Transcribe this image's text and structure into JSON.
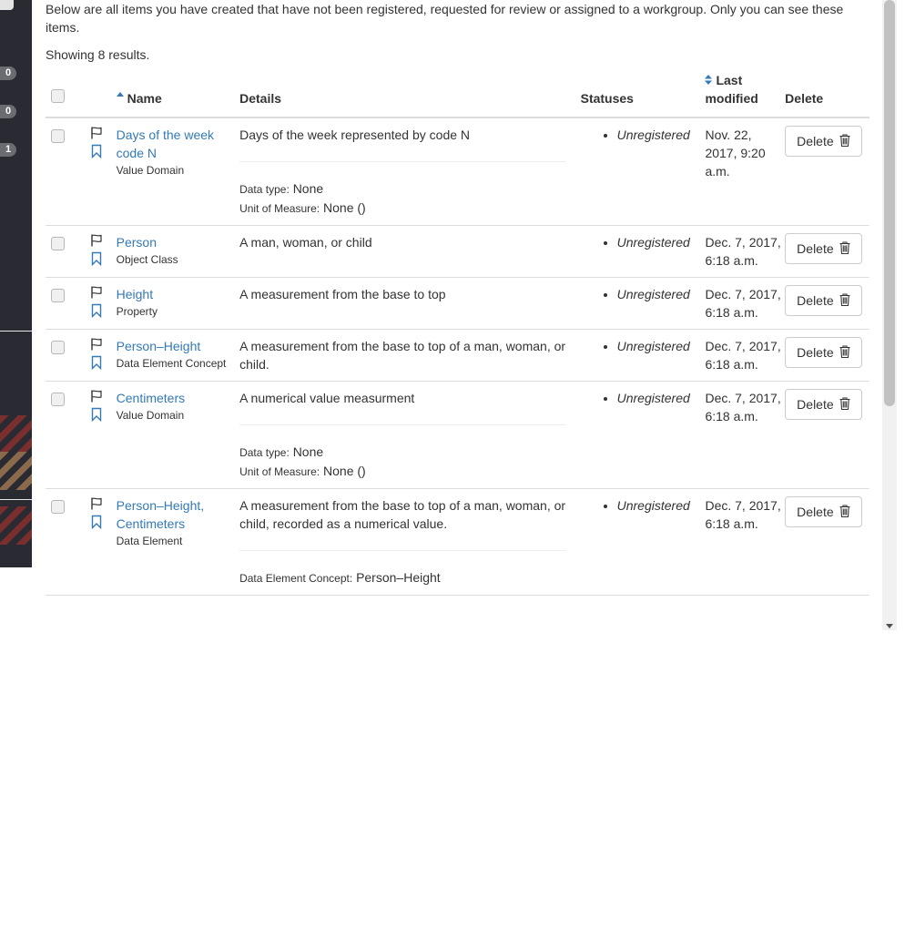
{
  "sidebar": {
    "badges": [
      "0",
      "0",
      "1"
    ]
  },
  "intro": "Below are all items you have created that have not been registered, requested for review or assigned to a workgroup. Only you can see these items.",
  "results_text": "Showing 8 results.",
  "table": {
    "headers": {
      "name": "Name",
      "details": "Details",
      "statuses": "Statuses",
      "last_modified": "Last modified",
      "delete": "Delete"
    },
    "rows": [
      {
        "name": "Days of the week code N",
        "type": "Value Domain",
        "description": "Days of the week represented by code N",
        "data_type_label": "Data type:",
        "data_type": "None",
        "uom_label": "Unit of Measure:",
        "uom": "None ()",
        "status": "Unregistered",
        "modified": "Nov. 22, 2017, 9:20 a.m.",
        "delete_label": "Delete"
      },
      {
        "name": "Person",
        "type": "Object Class",
        "description": "A man, woman, or child",
        "status": "Unregistered",
        "modified": "Dec. 7, 2017, 6:18 a.m.",
        "delete_label": "Delete"
      },
      {
        "name": "Height",
        "type": "Property",
        "description": "A measurement from the base to top",
        "status": "Unregistered",
        "modified": "Dec. 7, 2017, 6:18 a.m.",
        "delete_label": "Delete"
      },
      {
        "name": "Person–Height",
        "type": "Data Element Concept",
        "description": "A measurement from the base to top of a man, woman, or child.",
        "status": "Unregistered",
        "modified": "Dec. 7, 2017, 6:18 a.m.",
        "delete_label": "Delete"
      },
      {
        "name": "Centimeters",
        "type": "Value Domain",
        "description": "A numerical value measurment",
        "data_type_label": "Data type:",
        "data_type": "None",
        "uom_label": "Unit of Measure:",
        "uom": "None ()",
        "status": "Unregistered",
        "modified": "Dec. 7, 2017, 6:18 a.m.",
        "delete_label": "Delete"
      },
      {
        "name": "Person–Height, Centimeters",
        "type": "Data Element",
        "description": "A measurement from the base to top of a man, woman, or child, recorded as a numerical value.",
        "dec_label": "Data Element Concept:",
        "dec": "Person–Height",
        "status": "Unregistered",
        "modified": "Dec. 7, 2017, 6:18 a.m.",
        "delete_label": "Delete"
      }
    ]
  },
  "colors": {
    "link": "#337ab7",
    "sidebar": "#2a2a33"
  }
}
